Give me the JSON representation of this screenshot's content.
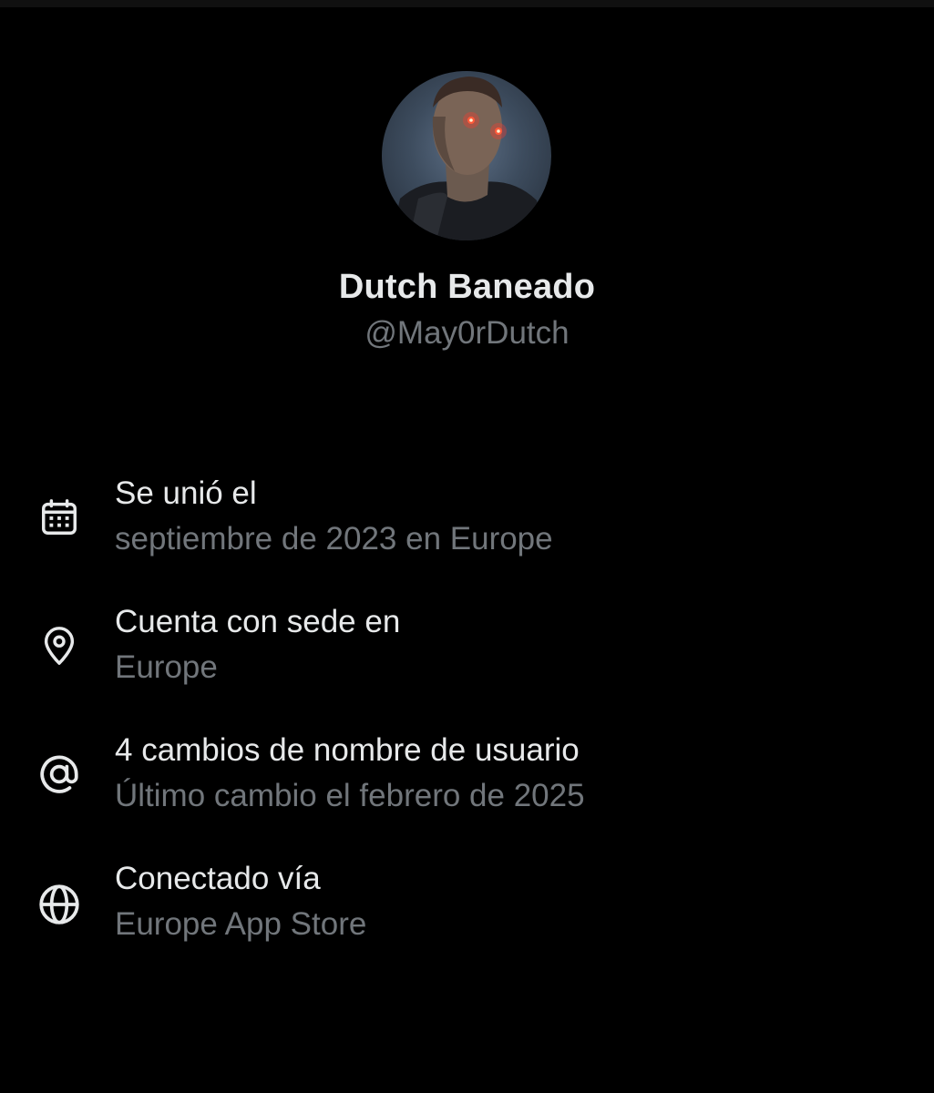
{
  "profile": {
    "display_name": "Dutch Baneado",
    "handle": "@May0rDutch"
  },
  "info_items": [
    {
      "icon": "calendar-icon",
      "title": "Se unió el",
      "subtitle": "septiembre de 2023 en Europe"
    },
    {
      "icon": "location-pin-icon",
      "title": "Cuenta con sede en",
      "subtitle": "Europe"
    },
    {
      "icon": "at-sign-icon",
      "title": "4 cambios de nombre de usuario",
      "subtitle": "Último cambio el febrero de 2025"
    },
    {
      "icon": "globe-icon",
      "title": "Conectado vía",
      "subtitle": "Europe App Store"
    }
  ],
  "colors": {
    "background": "#000000",
    "primary_text": "#e7e9ea",
    "secondary_text": "#71767b"
  }
}
